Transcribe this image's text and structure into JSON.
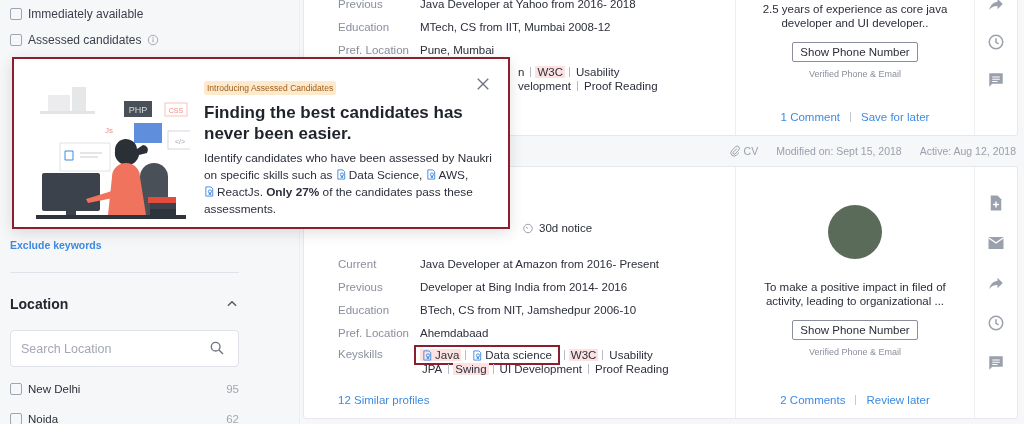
{
  "sidebar": {
    "filters": [
      {
        "label": "Immediately available",
        "checked": false,
        "info": false
      },
      {
        "label": "Assessed candidates",
        "checked": false,
        "info": true
      }
    ],
    "exclude_link": "Exclude keywords",
    "location": {
      "title": "Location",
      "expanded": true,
      "search": {
        "placeholder": "Search Location"
      },
      "options": [
        {
          "label": "New Delhi",
          "count": "95",
          "checked": false
        },
        {
          "label": "Noida",
          "count": "62",
          "checked": false
        }
      ]
    }
  },
  "results": [
    {
      "kind": "card",
      "details": [
        {
          "label": "Previous",
          "value": "Java Developer at Yahoo from 2016- 2018"
        },
        {
          "label": "Education",
          "value": "MTech, CS from IIT, Mumbai 2008-12"
        },
        {
          "label": "Pref. Location",
          "value": "Pune, Mumbai"
        }
      ],
      "keyskills": {
        "lines": [
          [
            {
              "text": "n",
              "assessed": false,
              "highlighted": false,
              "framed": false
            },
            {
              "text": "W3C",
              "assessed": false,
              "highlighted": true,
              "framed": false
            },
            {
              "text": "Usability",
              "assessed": false,
              "highlighted": false,
              "framed": false
            }
          ],
          [
            {
              "text": "velopment",
              "assessed": false,
              "highlighted": false,
              "framed": false
            },
            {
              "text": "Proof Reading",
              "assessed": false,
              "highlighted": false,
              "framed": false
            }
          ]
        ]
      },
      "photo": false,
      "summary": "2.5 years of experience as core java developer and UI developer..",
      "phone_button": "Show Phone Number",
      "verified": "Verified Phone & Email",
      "links": [
        "1 Comment",
        "Save for later"
      ],
      "actions": [
        {
          "kind": "share"
        },
        {
          "kind": "clock"
        },
        {
          "kind": "comment"
        }
      ]
    },
    {
      "kind": "meta",
      "attachment": "CV",
      "modified": "Modified on: Sept 15, 2018",
      "active": "Active: Aug 12, 2018"
    },
    {
      "kind": "card",
      "notice": "30d notice",
      "details": [
        {
          "label": "Current",
          "value": "Java Developer at Amazon from 2016- Present"
        },
        {
          "label": "Previous",
          "value": "Developer at Bing India from 2014- 2016"
        },
        {
          "label": "Education",
          "value": "BTech, CS from NIT, Jamshedpur 2006-10"
        },
        {
          "label": "Pref. Location",
          "value": "Ahemdabaad"
        }
      ],
      "keyskills": {
        "label": "Keyskills",
        "lines": [
          [
            {
              "text": "Java",
              "assessed": true,
              "highlighted": true,
              "framed": true
            },
            {
              "text": "Data science",
              "assessed": true,
              "highlighted": false,
              "framed": true
            },
            {
              "text": "W3C",
              "assessed": false,
              "highlighted": true,
              "framed": false
            },
            {
              "text": "Usability",
              "assessed": false,
              "highlighted": false,
              "framed": false
            }
          ],
          [
            {
              "text": "JPA",
              "assessed": false,
              "highlighted": false,
              "framed": false
            },
            {
              "text": "Swing",
              "assessed": false,
              "highlighted": true,
              "framed": false
            },
            {
              "text": "UI Development",
              "assessed": false,
              "highlighted": false,
              "framed": false
            },
            {
              "text": "Proof Reading",
              "assessed": false,
              "highlighted": false,
              "framed": false
            }
          ]
        ]
      },
      "similar": "12 Similar profiles",
      "photo": true,
      "summary": "To make a positive impact in filed of activity, leading to organizational ...",
      "phone_button": "Show Phone Number",
      "verified": "Verified Phone & Email",
      "links": [
        "2 Comments",
        "Review later"
      ],
      "actions": [
        {
          "kind": "add-file"
        },
        {
          "kind": "mail"
        },
        {
          "kind": "share"
        },
        {
          "kind": "clock"
        },
        {
          "kind": "comment"
        }
      ]
    }
  ],
  "popup": {
    "badge": "Introducing Assessed Candidates",
    "title": "Finding the best candidates has never been easier.",
    "illustration_labels": [
      "PHP",
      "CSS",
      "Js",
      "</>"
    ],
    "body": [
      {
        "kind": "text",
        "text": "Identify candidates who have been assessed by Naukri on specific skills such as "
      },
      {
        "kind": "skill",
        "text": "Data Science"
      },
      {
        "kind": "text",
        "text": ", "
      },
      {
        "kind": "skill",
        "text": "AWS"
      },
      {
        "kind": "text",
        "text": ", "
      },
      {
        "kind": "skill",
        "text": "ReactJs"
      },
      {
        "kind": "text",
        "text": ". **Only 27%** of the candidates pass these assessments."
      }
    ]
  }
}
